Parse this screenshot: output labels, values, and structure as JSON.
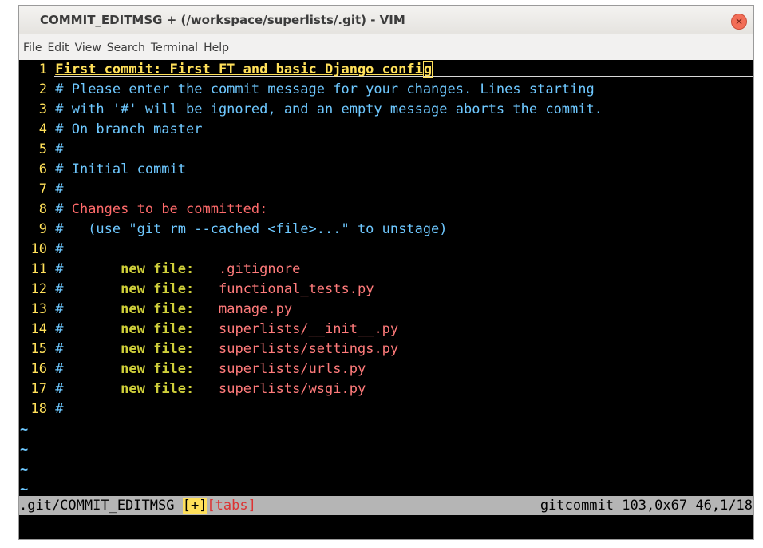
{
  "window": {
    "title": "COMMIT_EDITMSG + (/workspace/superlists/.git) - VIM"
  },
  "menu": [
    "File",
    "Edit",
    "View",
    "Search",
    "Terminal",
    "Help"
  ],
  "editor": {
    "subject_line": "First commit: First FT and basic Django confi",
    "cursor_char": "g",
    "lines": [
      {
        "n": "1"
      },
      {
        "n": "2",
        "text": "# Please enter the commit message for your changes. Lines starting"
      },
      {
        "n": "3",
        "text": "# with '#' will be ignored, and an empty message aborts the commit."
      },
      {
        "n": "4",
        "text": "# On branch master"
      },
      {
        "n": "5",
        "text": "#"
      },
      {
        "n": "6",
        "text": "# Initial commit"
      },
      {
        "n": "7",
        "text": "#"
      },
      {
        "n": "8",
        "prefix": "# ",
        "changes": "Changes to be committed:"
      },
      {
        "n": "9",
        "text": "#   (use \"git rm --cached <file>...\" to unstage)"
      },
      {
        "n": "10",
        "text": "#"
      },
      {
        "n": "11",
        "prefix": "#       ",
        "nf": "new file:",
        "gap": "   ",
        "file": ".gitignore"
      },
      {
        "n": "12",
        "prefix": "#       ",
        "nf": "new file:",
        "gap": "   ",
        "file": "functional_tests.py"
      },
      {
        "n": "13",
        "prefix": "#       ",
        "nf": "new file:",
        "gap": "   ",
        "file": "manage.py"
      },
      {
        "n": "14",
        "prefix": "#       ",
        "nf": "new file:",
        "gap": "   ",
        "file": "superlists/__init__.py"
      },
      {
        "n": "15",
        "prefix": "#       ",
        "nf": "new file:",
        "gap": "   ",
        "file": "superlists/settings.py"
      },
      {
        "n": "16",
        "prefix": "#       ",
        "nf": "new file:",
        "gap": "   ",
        "file": "superlists/urls.py"
      },
      {
        "n": "17",
        "prefix": "#       ",
        "nf": "new file:",
        "gap": "   ",
        "file": "superlists/wsgi.py"
      },
      {
        "n": "18",
        "text": "#"
      }
    ],
    "tildes": [
      "~",
      "~",
      "~",
      "~"
    ]
  },
  "status": {
    "file": ".git/COMMIT_EDITMSG ",
    "modified": "[+]",
    "tabs": "[tabs]",
    "right": "gitcommit 103,0x67 46,1/18"
  }
}
